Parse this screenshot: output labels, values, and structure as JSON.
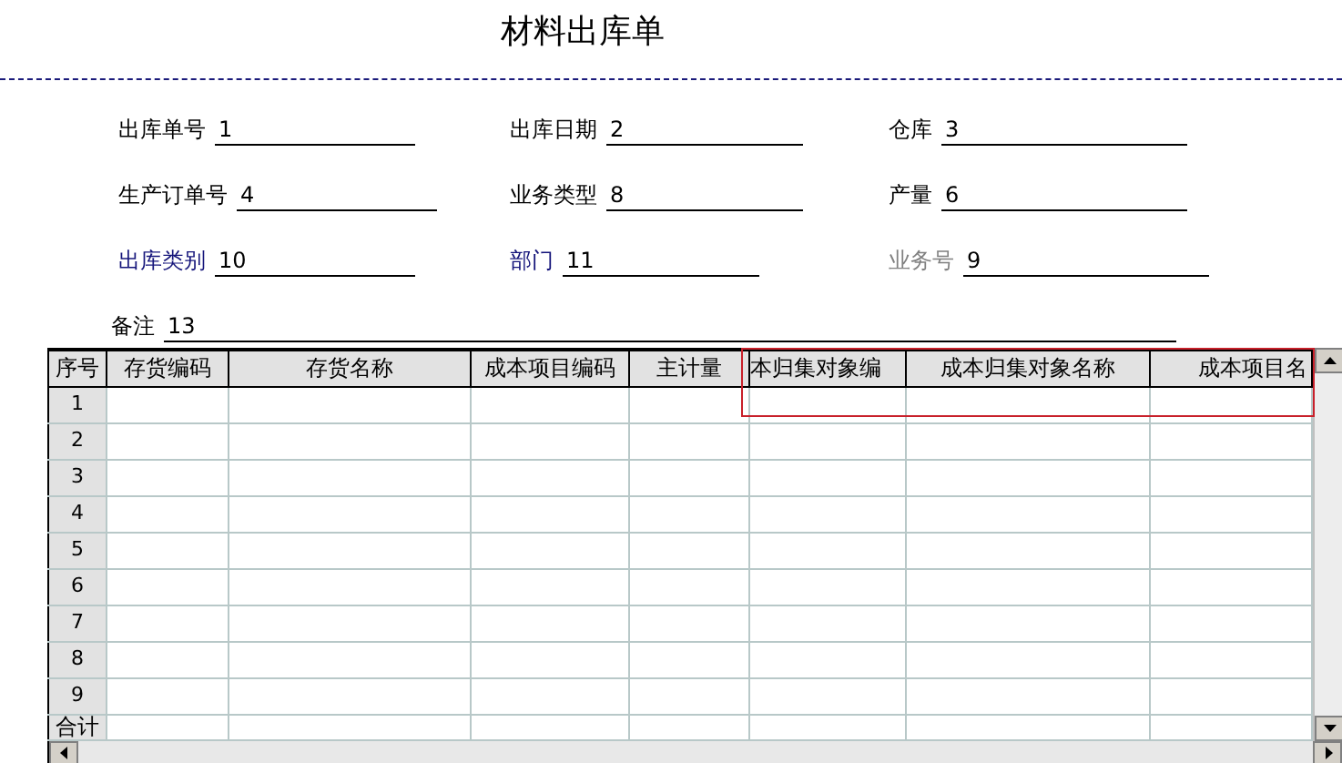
{
  "title": "材料出库单",
  "fields": [
    {
      "label": "出库单号",
      "value": "1",
      "kind": "plain"
    },
    {
      "label": "出库日期",
      "value": "2",
      "kind": "plain"
    },
    {
      "label": "仓库",
      "value": "3",
      "kind": "plain"
    },
    {
      "label": "生产订单号",
      "value": "4",
      "kind": "plain"
    },
    {
      "label": "业务类型",
      "value": "8",
      "kind": "plain"
    },
    {
      "label": "产量",
      "value": "6",
      "kind": "plain"
    },
    {
      "label": "出库类别",
      "value": "10",
      "kind": "reference"
    },
    {
      "label": "部门",
      "value": "11",
      "kind": "reference"
    },
    {
      "label": "业务号",
      "value": "9",
      "kind": "readonly"
    }
  ],
  "remark": {
    "label": "备注",
    "value": "13"
  },
  "table": {
    "columns": [
      {
        "label": "序号",
        "highlighted": false
      },
      {
        "label": "存货编码",
        "highlighted": false
      },
      {
        "label": "存货名称",
        "highlighted": false
      },
      {
        "label": "成本项目编码",
        "highlighted": false
      },
      {
        "label": "主计量",
        "highlighted": false
      },
      {
        "label": "本归集对象编",
        "highlighted": true
      },
      {
        "label": "成本归集对象名称",
        "highlighted": true
      },
      {
        "label": "成本项目名",
        "highlighted": true
      }
    ],
    "rows": [
      "1",
      "2",
      "3",
      "4",
      "5",
      "6",
      "7",
      "8",
      "9"
    ],
    "total_label": "合计"
  }
}
